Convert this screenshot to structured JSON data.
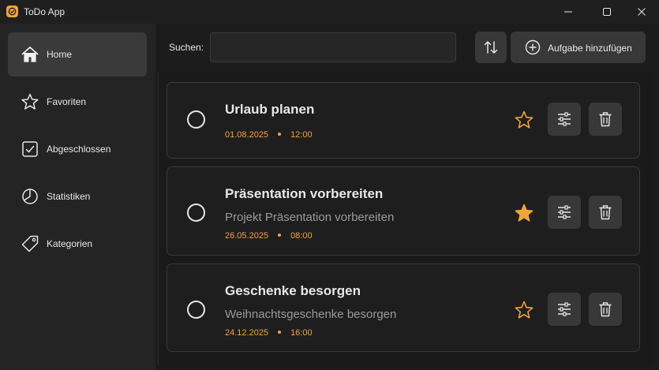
{
  "window": {
    "title": "ToDo App"
  },
  "sidebar": {
    "items": [
      {
        "label": "Home",
        "icon": "home-icon",
        "active": true
      },
      {
        "label": "Favoriten",
        "icon": "star-icon",
        "active": false
      },
      {
        "label": "Abgeschlossen",
        "icon": "checkbox-icon",
        "active": false
      },
      {
        "label": "Statistiken",
        "icon": "pie-chart-icon",
        "active": false
      },
      {
        "label": "Kategorien",
        "icon": "tag-icon",
        "active": false
      }
    ]
  },
  "toolbar": {
    "search_label": "Suchen:",
    "search_value": "",
    "sort_icon": "sort-icon",
    "add_label": "Aufgabe hinzufügen",
    "add_icon": "plus-circle-icon"
  },
  "tasks": [
    {
      "title": "Urlaub planen",
      "description": "",
      "date": "01.08.2025",
      "time": "12:00",
      "favorite": false
    },
    {
      "title": "Präsentation vorbereiten",
      "description": "Projekt Präsentation vorbereiten",
      "date": "26.05.2025",
      "time": "08:00",
      "favorite": true
    },
    {
      "title": "Geschenke besorgen",
      "description": "Weihnachtsgeschenke besorgen",
      "date": "24.12.2025",
      "time": "16:00",
      "favorite": false
    }
  ],
  "colors": {
    "accent": "#f0a43a",
    "background": "#1c1c1c",
    "sidebar": "#242424",
    "button": "#383838"
  }
}
